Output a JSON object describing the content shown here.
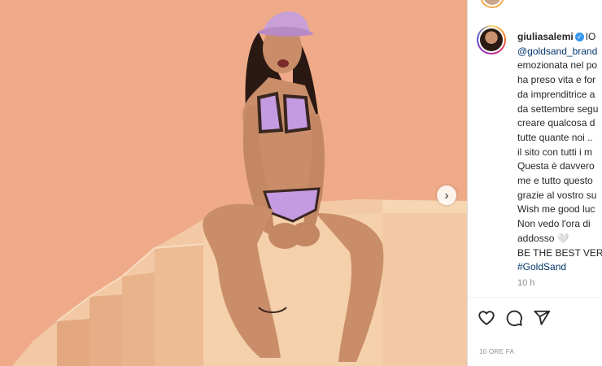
{
  "post": {
    "image_alt": "",
    "next_icon": "chevron-right-icon"
  },
  "author": {
    "username": "giuliasalemi",
    "verified": true,
    "avatar": "avatar"
  },
  "caption": {
    "lines": [
      "IO",
      "@goldsand_brand",
      "emozionata nel po",
      "ha preso vita e for",
      "da imprenditrice a",
      "da settembre segu",
      "creare qualcosa d",
      "tutte quante noi ..",
      "il sito con tutti i m",
      "Questa è davvero",
      "me e tutto questo",
      "grazie al vostro su",
      "Wish me good luc",
      "Non vedo l'ora di",
      "addosso 🤍",
      "BE THE BEST VERS",
      "#GoldSand"
    ]
  },
  "meta": {
    "time_ago": "10 h",
    "posted_label": "10 ORE FA"
  },
  "actions": {
    "like_icon": "heart-icon",
    "comment_icon": "comment-icon",
    "share_icon": "share-icon"
  },
  "colors": {
    "background_photo": "#f0ae8c",
    "link": "#00376b",
    "verified": "#3897f0",
    "muted_text": "#8e8e8e"
  }
}
